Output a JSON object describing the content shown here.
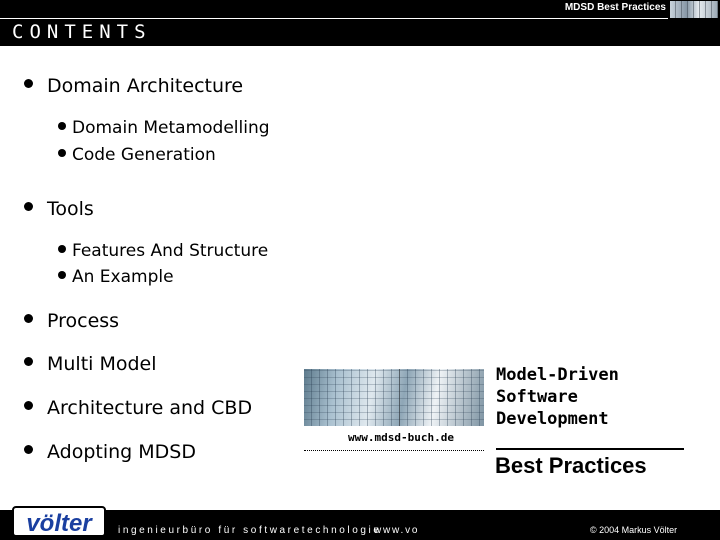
{
  "header": {
    "label": "MDSD Best Practices",
    "title": "CONTENTS"
  },
  "contents": [
    {
      "label": "Domain Architecture",
      "children": [
        {
          "label": "Domain Metamodelling"
        },
        {
          "label": "Code Generation"
        }
      ]
    },
    {
      "label": "Tools",
      "children": [
        {
          "label": "Features And Structure"
        },
        {
          "label": "An Example"
        }
      ]
    },
    {
      "label": "Process"
    },
    {
      "label": "Multi Model"
    },
    {
      "label": "Architecture and CBD"
    },
    {
      "label": "Adopting MDSD"
    }
  ],
  "book": {
    "title_lines": [
      "Model-Driven",
      "Software",
      "Development"
    ],
    "subtitle": "Best Practices",
    "url": "www.mdsd-buch.de"
  },
  "footer": {
    "logo": "völter",
    "tagline": "ingenieurbüro für softwaretechnologie",
    "url": "www.vo",
    "copyright": "© 2004 Markus Völter"
  }
}
